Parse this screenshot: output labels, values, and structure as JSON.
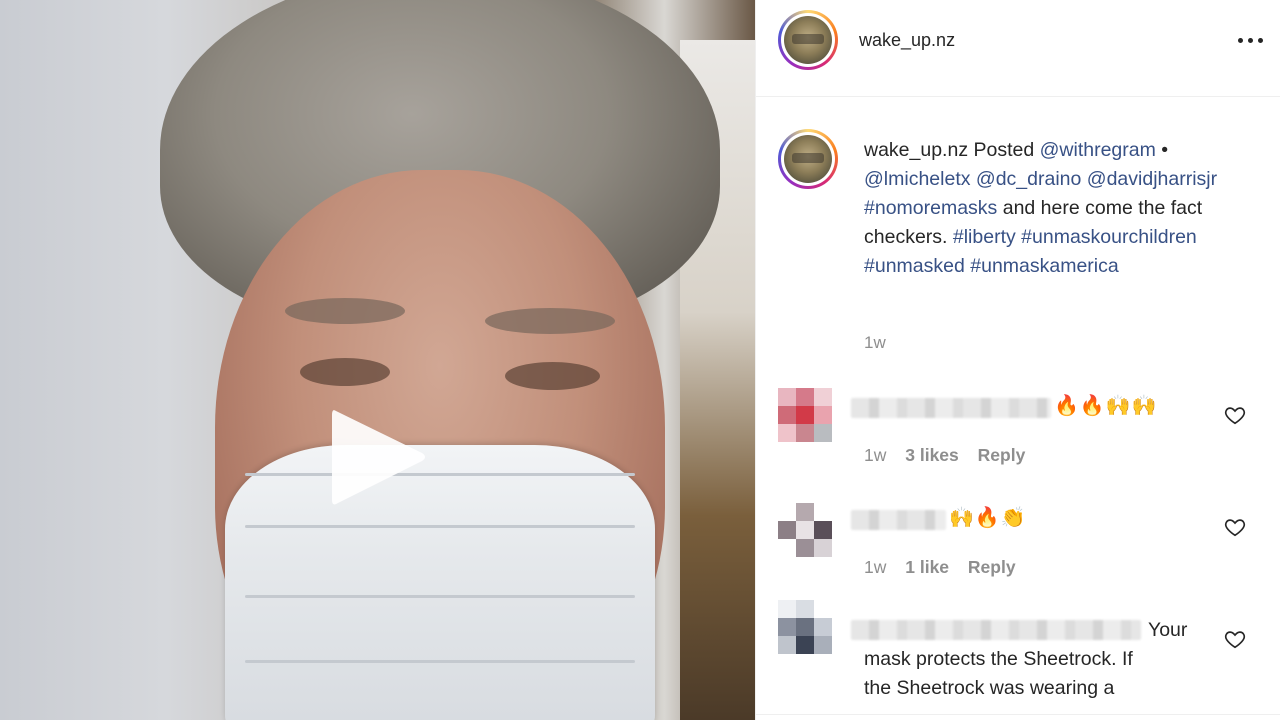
{
  "post": {
    "username": "wake_up.nz",
    "more_icon": "more-horizontal-icon"
  },
  "media": {
    "type": "video",
    "play_icon": "play-icon"
  },
  "caption": {
    "username": "wake_up.nz",
    "text_parts": [
      {
        "text": " Posted ",
        "kind": "text"
      },
      {
        "text": "@withregram",
        "kind": "link"
      },
      {
        "text": " • ",
        "kind": "text"
      },
      {
        "text": "@lmicheletx",
        "kind": "link"
      },
      {
        "text": " ",
        "kind": "text"
      },
      {
        "text": "@dc_draino",
        "kind": "link"
      },
      {
        "text": " ",
        "kind": "text"
      },
      {
        "text": "@davidjharrisjr",
        "kind": "link"
      },
      {
        "text": " ",
        "kind": "text"
      },
      {
        "text": "#nomoremasks",
        "kind": "link"
      },
      {
        "text": " and here come the fact checkers. ",
        "kind": "text"
      },
      {
        "text": "#liberty",
        "kind": "link"
      },
      {
        "text": " ",
        "kind": "text"
      },
      {
        "text": "#unmaskourchildren",
        "kind": "link"
      },
      {
        "text": " ",
        "kind": "text"
      },
      {
        "text": "#unmasked",
        "kind": "link"
      },
      {
        "text": " ",
        "kind": "text"
      },
      {
        "text": "#unmaskamerica",
        "kind": "link"
      }
    ],
    "time": "1w"
  },
  "comments": [
    {
      "emojis": "🔥🔥🙌🙌",
      "time": "1w",
      "likes": "3 likes",
      "reply": "Reply",
      "avatar_colors": [
        "#e8b6c0",
        "#d57a8a",
        "#f0d0d6",
        "#cf6b78",
        "#d23a48",
        "#e9a3ae",
        "#efc3ca",
        "#c9868f",
        "#b9bcc0"
      ]
    },
    {
      "emojis": "🙌🔥👏",
      "time": "1w",
      "likes": "1 like",
      "reply": "Reply",
      "avatar_colors": [
        "#ffffff",
        "#b5a9ae",
        "#ffffff",
        "#8c7f86",
        "#e8e2e5",
        "#5a4f59",
        "#ffffff",
        "#9b8f96",
        "#d8d2d6"
      ]
    },
    {
      "text_lines": [
        "Your",
        "mask protects the Sheetrock. If",
        "the Sheetrock was wearing a"
      ],
      "avatar_colors": [
        "#eef0f3",
        "#d9dde3",
        "#ffffff",
        "#8c92a0",
        "#6a7180",
        "#c7ccd5",
        "#bfc4cc",
        "#3b4354",
        "#a9afba"
      ]
    }
  ]
}
